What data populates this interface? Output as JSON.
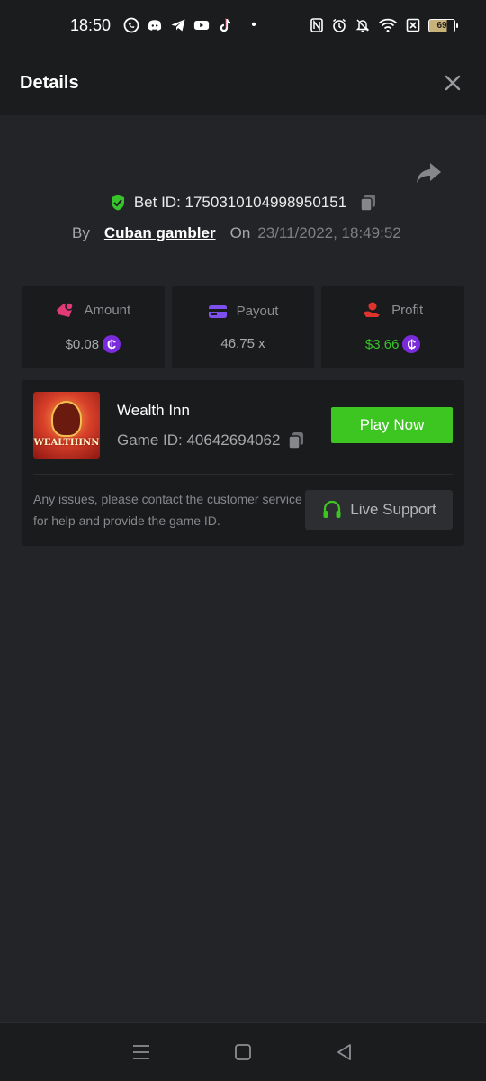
{
  "status_bar": {
    "time": "18:50",
    "apps": [
      "whatsapp-icon",
      "discord-icon",
      "telegram-icon",
      "youtube-icon",
      "tiktok-icon"
    ],
    "dot": "•",
    "battery": "69"
  },
  "header": {
    "title": "Details",
    "close_icon": "close-icon"
  },
  "bet": {
    "id_label": "Bet ID: 1750310104998950151",
    "by_label": "By",
    "user": "Cuban gambler",
    "on_label": "On",
    "datetime": "23/11/2022, 18:49:52"
  },
  "stats": [
    {
      "label": "Amount",
      "value": "$0.08",
      "icon": "amount-icon",
      "color": "#e23a76",
      "coin": true
    },
    {
      "label": "Payout",
      "value": "46.75 x",
      "icon": "payout-card-icon",
      "color": "#7d4ff0",
      "coin": false
    },
    {
      "label": "Profit",
      "value": "$3.66",
      "icon": "profit-icon",
      "color": "#e0332e",
      "coin": true,
      "value_color": "#37c32a"
    }
  ],
  "coin_symbol": "₵",
  "game": {
    "name": "Wealth Inn",
    "id_label": "Game ID: 40642694062",
    "thumb_text": "WEALTHINN",
    "play_label": "Play Now",
    "issue_text": "Any issues, please contact the customer service for help and provide the game ID.",
    "support_label": "Live Support"
  },
  "colors": {
    "background": "#232427",
    "bar": "#1b1c1e",
    "card": "#1a1b1d",
    "accent_green": "#3dc521",
    "shield_green": "#37c32a"
  }
}
